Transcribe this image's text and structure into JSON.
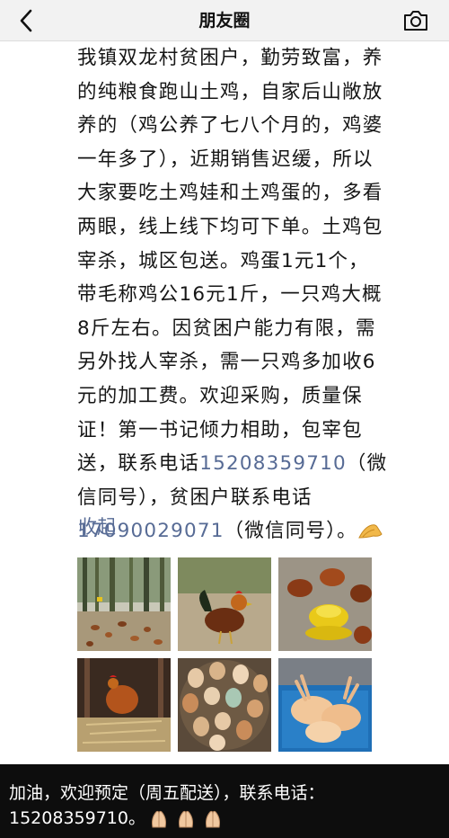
{
  "nav": {
    "title": "朋友圈",
    "back_icon": "chevron-left-icon",
    "camera_icon": "camera-icon"
  },
  "post": {
    "lines": [
      "我镇双龙村贫困户，勤劳致富，养",
      "的纯粮食跑山土鸡，自家后山敞放",
      "养的（鸡公养了七八个月的，鸡婆",
      "一年多了），近期销售迟缓，所以",
      "大家要吃土鸡娃和土鸡蛋的，多看",
      "两眼，线上线下均可下单。土鸡包",
      "宰杀，城区包送。鸡蛋1元1个，",
      "带毛称鸡公16元1斤，一只鸡大概",
      "8斤左右。因贫困户能力有限，需",
      "另外找人宰杀，需一只鸡多加收6",
      "元的加工费。欢迎采购，质量保",
      "证！第一书记倾力相助，包宰包"
    ],
    "line13_prefix": "送，联系电话",
    "phone1": "15208359710",
    "line13_suffix": "（微",
    "line14": "信同号），贫困户联系电话",
    "phone2": "17090029071",
    "line15_suffix": "（微信同号）。",
    "emoji": "praying-hands-icon"
  },
  "collapse_label": "收起",
  "images": [
    {
      "name": "chickens-in-bamboo-forest"
    },
    {
      "name": "rooster-on-ground"
    },
    {
      "name": "chickens-around-yellow-feeder"
    },
    {
      "name": "hen-on-straw-nest"
    },
    {
      "name": "basket-of-eggs"
    },
    {
      "name": "plucked-chickens-in-blue-bin"
    }
  ],
  "bottom_bar": {
    "line1": "加油，欢迎预定（周五配送），联系电话：",
    "line2": "15208359710。"
  },
  "colors": {
    "link": "#576b95",
    "nav_bg": "#f2f2f2",
    "bottom_bg": "#0d0d0d"
  }
}
